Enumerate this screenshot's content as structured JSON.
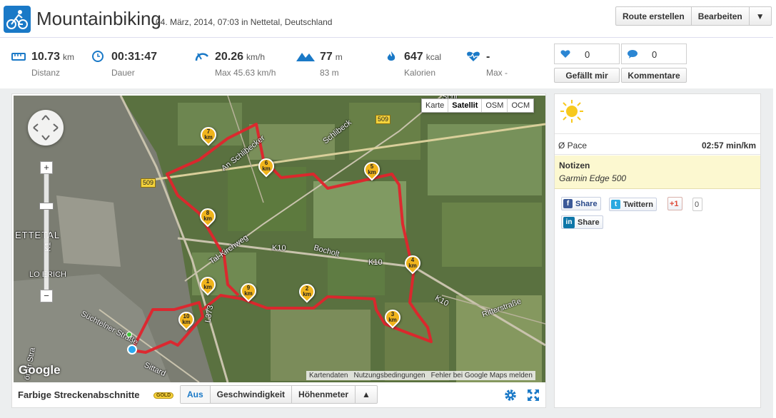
{
  "header": {
    "title": "Mountainbiking",
    "subtitle": "04. März, 2014, 07:03 in Nettetal, Deutschland",
    "buttons": {
      "route": "Route erstellen",
      "edit": "Bearbeiten",
      "menu": "▼"
    }
  },
  "stats": [
    {
      "icon": "ruler-icon",
      "value": "10.73",
      "unit": "km",
      "label": "Distanz"
    },
    {
      "icon": "clock-icon",
      "value": "00:31:47",
      "unit": "",
      "label": "Dauer"
    },
    {
      "icon": "speed-icon",
      "value": "20.26",
      "unit": "km/h",
      "label": "Max 45.63 km/h"
    },
    {
      "icon": "mountain-icon",
      "value": "77",
      "unit": "m",
      "label": "83 m"
    },
    {
      "icon": "flame-icon",
      "value": "647",
      "unit": "kcal",
      "label": "Kalorien"
    },
    {
      "icon": "heart-rate-icon",
      "value": "-",
      "unit": "",
      "label": "Max -"
    }
  ],
  "social": {
    "likes_count": "0",
    "comments_count": "0",
    "like_label": "Gefällt mir",
    "comments_label": "Kommentare"
  },
  "map": {
    "types": [
      "Karte",
      "Satellit",
      "OSM",
      "OCM"
    ],
    "active_type": "Satellit",
    "google_logo": "Google",
    "footer": [
      "Kartendaten",
      "Nutzungsbedingungen",
      "Fehler bei Google Maps melden"
    ],
    "places": {
      "nettetal": "ETTETAL",
      "lobberich": "LO   ERICH",
      "schlibeck": "Schlibeck",
      "schlibecker": "An Schlibecker",
      "kirchweg": "Tal-Kirchweg",
      "k10_a": "K10",
      "bocholt": "Bocholt",
      "k10_b": "K10",
      "k10_c": "K10",
      "ritter": "Ritterstraße",
      "sucht": "Süchtelner Straße",
      "sittard": "Sittard",
      "l373": "L373",
      "k1": "K1",
      "dorfer": "örfer Stra",
      "schi": "Schi"
    },
    "shields": {
      "r509a": "509",
      "r509b": "509"
    },
    "markers": [
      "1",
      "2",
      "3",
      "4",
      "5",
      "6",
      "7",
      "8",
      "9",
      "10"
    ],
    "marker_unit": "km"
  },
  "map_bar": {
    "title": "Farbige Streckenabschnitte",
    "badge": "GOLD",
    "segments": [
      "Aus",
      "Geschwindigkeit",
      "Höhenmeter",
      "▲"
    ],
    "active_segment": "Aus"
  },
  "info": {
    "weather_icon": "sun-icon",
    "pace_label": "Ø Pace",
    "pace_value": "02:57 min/km",
    "notes_label": "Notizen",
    "notes_value": "Garmin Edge 500",
    "share_buttons": {
      "facebook": "Share",
      "twitter": "Twittern",
      "gplus": "+1",
      "gplus_count": "0",
      "linkedin": "Share"
    }
  },
  "colors": {
    "accent": "#1a79c7",
    "route": "#e0242c",
    "marker": "#f0b41c",
    "notes_bg": "#fcf8d0"
  }
}
